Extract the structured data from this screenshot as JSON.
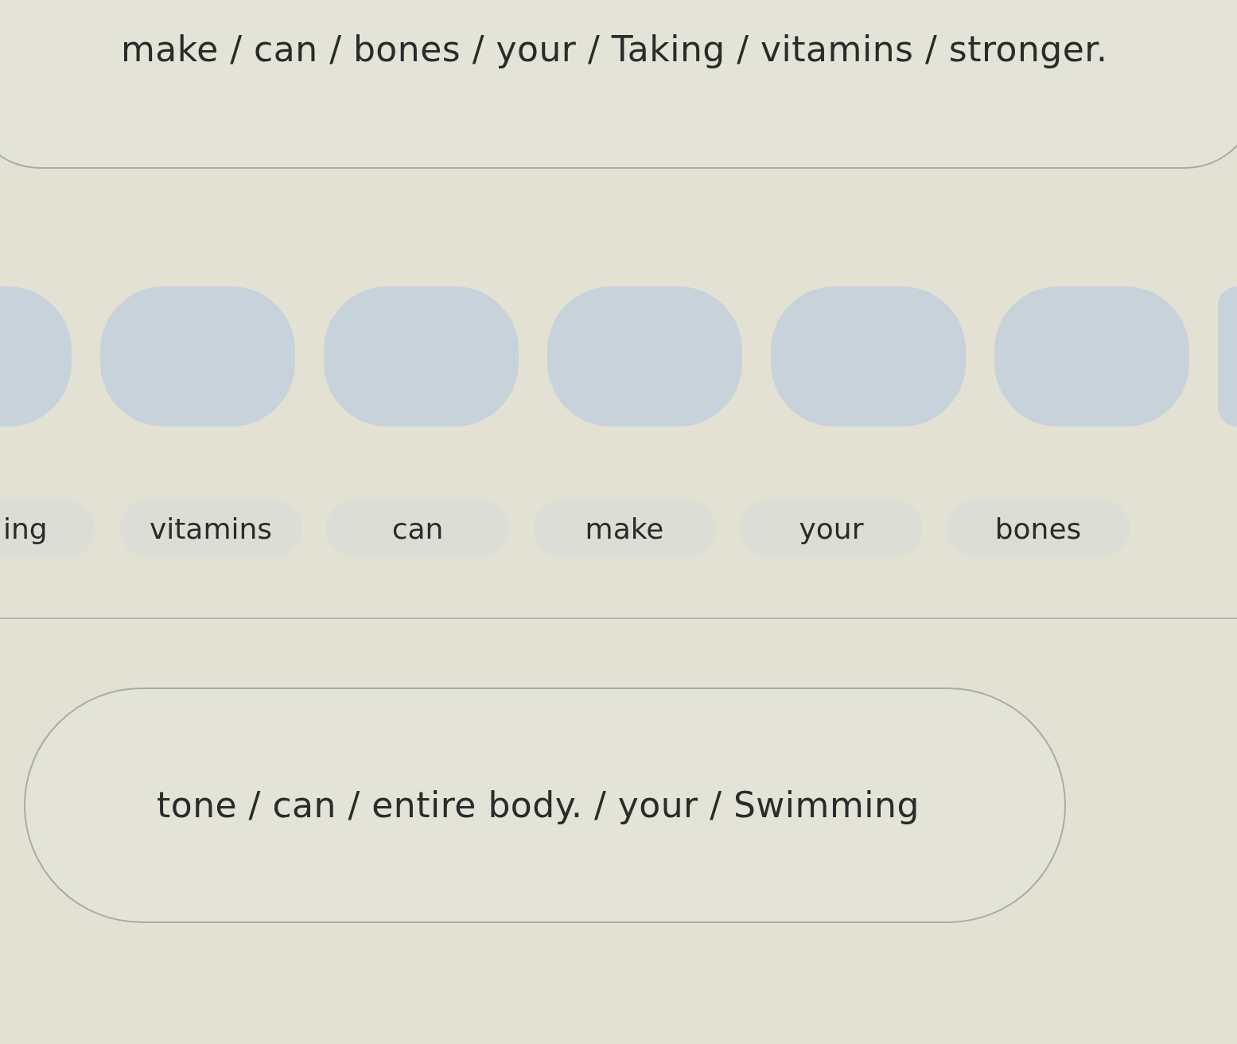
{
  "question_top": {
    "scrambled": "make / can / bones / your / Taking / vitamins / stronger."
  },
  "answer_slots": [
    {
      "filled": false
    },
    {
      "filled": false
    },
    {
      "filled": false
    },
    {
      "filled": false
    },
    {
      "filled": false
    },
    {
      "filled": false
    },
    {
      "filled": false
    }
  ],
  "word_bank": [
    "ing",
    "vitamins",
    "can",
    "make",
    "your",
    "bones"
  ],
  "question_next": {
    "scrambled": "tone / can / entire body. / your / Swimming"
  }
}
